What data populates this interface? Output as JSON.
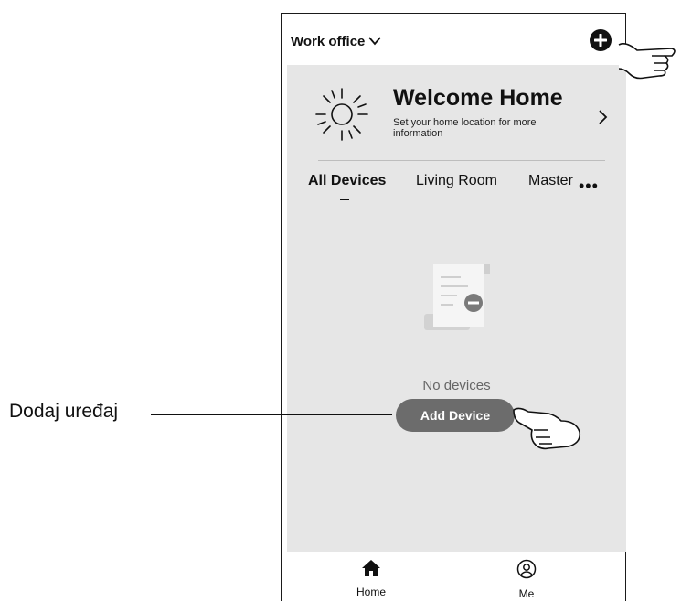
{
  "header": {
    "home_name": "Work office"
  },
  "weather": {
    "title": "Welcome Home",
    "subtitle": "Set your home location for more information"
  },
  "tabs": [
    {
      "label": "All Devices",
      "active": true
    },
    {
      "label": "Living Room",
      "active": false
    },
    {
      "label": "Master",
      "active": false
    }
  ],
  "tabs_more": "•••",
  "empty_state": {
    "text": "No devices",
    "button_label": "Add Device"
  },
  "bottom_nav": [
    {
      "label": "Home",
      "icon": "home-icon"
    },
    {
      "label": "Me",
      "icon": "user-circle-icon"
    }
  ],
  "callout": {
    "label": "Dodaj uređaj"
  },
  "colors": {
    "panel_bg": "#e6e6e6",
    "button_bg": "#6c6c6c"
  }
}
